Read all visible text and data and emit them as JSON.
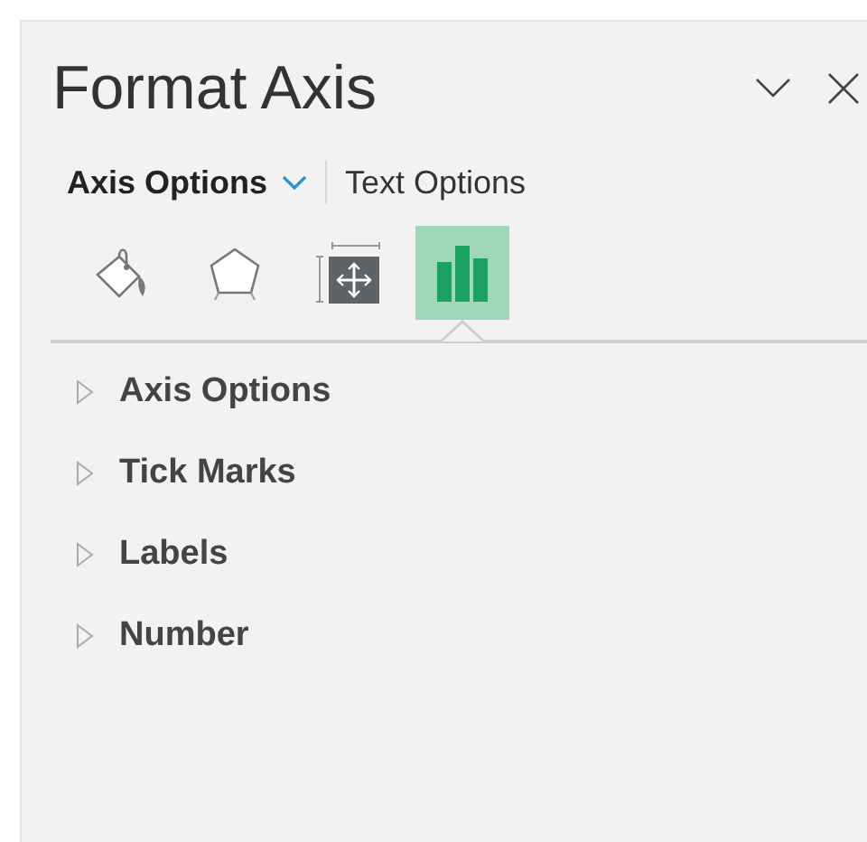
{
  "pane": {
    "title": "Format Axis"
  },
  "tabs": [
    {
      "label": "Axis Options",
      "selected": true
    },
    {
      "label": "Text Options",
      "selected": false
    }
  ],
  "icon_tabs": [
    {
      "kind": "fill",
      "selected": false
    },
    {
      "kind": "effects",
      "selected": false
    },
    {
      "kind": "size",
      "selected": false
    },
    {
      "kind": "options",
      "selected": true
    }
  ],
  "sections": [
    {
      "label": "Axis Options",
      "expanded": false
    },
    {
      "label": "Tick Marks",
      "expanded": false
    },
    {
      "label": "Labels",
      "expanded": false
    },
    {
      "label": "Number",
      "expanded": false
    }
  ]
}
